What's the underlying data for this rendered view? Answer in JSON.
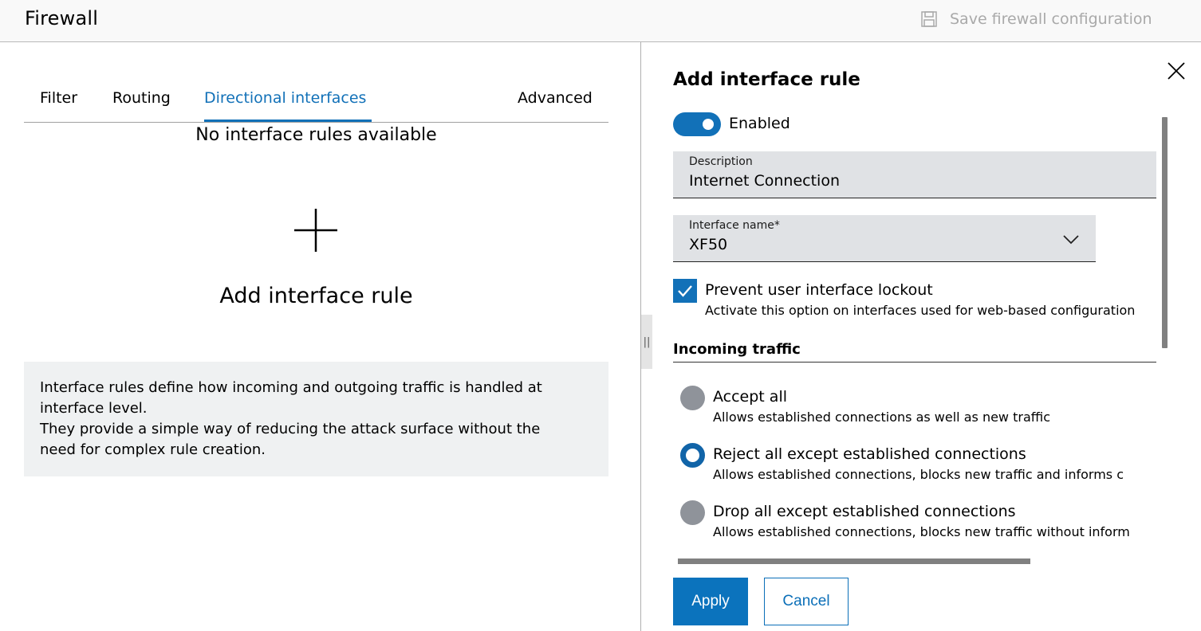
{
  "header": {
    "title": "Firewall",
    "save_label": "Save firewall configuration"
  },
  "tabs": [
    {
      "label": "Filter"
    },
    {
      "label": "Routing"
    },
    {
      "label": "Directional interfaces"
    },
    {
      "label": "Advanced"
    }
  ],
  "main": {
    "empty_title": "No interface rules available",
    "add_label": "Add interface rule",
    "info_lines": [
      "Interface rules define how incoming and outgoing traffic is handled at",
      "interface level.",
      "They provide a simple way of reducing the attack surface without the",
      "need for complex rule creation."
    ]
  },
  "panel": {
    "title": "Add interface rule",
    "toggle_label": "Enabled",
    "description": {
      "label": "Description",
      "value": "Internet Connection"
    },
    "interface_name": {
      "label": "Interface name*",
      "value": "XF50"
    },
    "lockout": {
      "label": "Prevent user interface lockout",
      "desc": "Activate this option on interfaces used for web-based configuration"
    },
    "section_title": "Incoming traffic",
    "radios": [
      {
        "label": "Accept all",
        "desc": "Allows established connections as well as new traffic"
      },
      {
        "label": "Reject all except established connections",
        "desc": "Allows established connections, blocks new traffic and informs c"
      },
      {
        "label": "Drop all except established connections",
        "desc": "Allows established connections, blocks new traffic without inform"
      }
    ],
    "apply_label": "Apply",
    "cancel_label": "Cancel"
  },
  "colors": {
    "accent": "#1271b8",
    "radio_off": "#8f939a",
    "field_bg": "#e0e2e5",
    "info_bg": "#eff1f2"
  }
}
